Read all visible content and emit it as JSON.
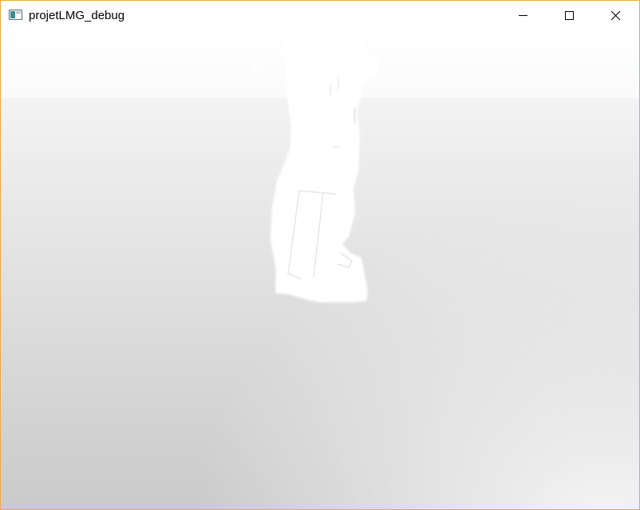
{
  "window": {
    "title": "projetLMG_debug",
    "frame_color": "#f0a742",
    "icon": "app-window-icon"
  },
  "controls": {
    "minimize_icon": "minimize-icon",
    "maximize_icon": "maximize-icon",
    "close_icon": "close-icon"
  },
  "scene": {
    "sky_color": "#ffffff",
    "floor_color_near": "#cacaca",
    "floor_color_far": "#f3f3f3",
    "model_color": "#ffffff"
  }
}
